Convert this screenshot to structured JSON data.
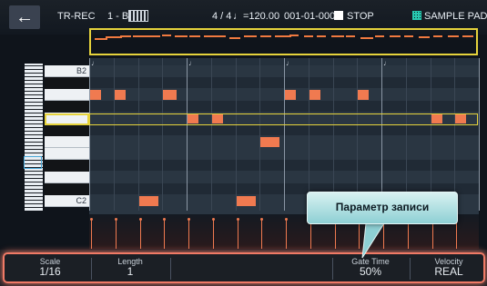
{
  "header": {
    "back_icon": "left-arrow-icon",
    "mode": "TR-REC",
    "pattern": "1 - B",
    "kit_icon": "drum-kit-icon",
    "time_signature": "4 / 4",
    "tempo": "♩=120.00",
    "position": "001-01-000",
    "stop_label": "STOP",
    "sample_pad_label": "SAMPLE PAD"
  },
  "roll": {
    "beat_marker": "♩",
    "key_top_label": "B2",
    "key_bottom_label": "C2"
  },
  "callout": {
    "text": "Параметр записи"
  },
  "footer": {
    "scale": {
      "label": "Scale",
      "value": "1/16"
    },
    "length": {
      "label": "Length",
      "value": "1"
    },
    "gate_time": {
      "label": "Gate Time",
      "value": "50%"
    },
    "velocity": {
      "label": "Velocity",
      "value": "REAL"
    }
  },
  "colors": {
    "note": "#f07a50",
    "selection": "#e6d33c",
    "callout": "#8ed0d4",
    "accent_pad": "#28c8b0"
  }
}
